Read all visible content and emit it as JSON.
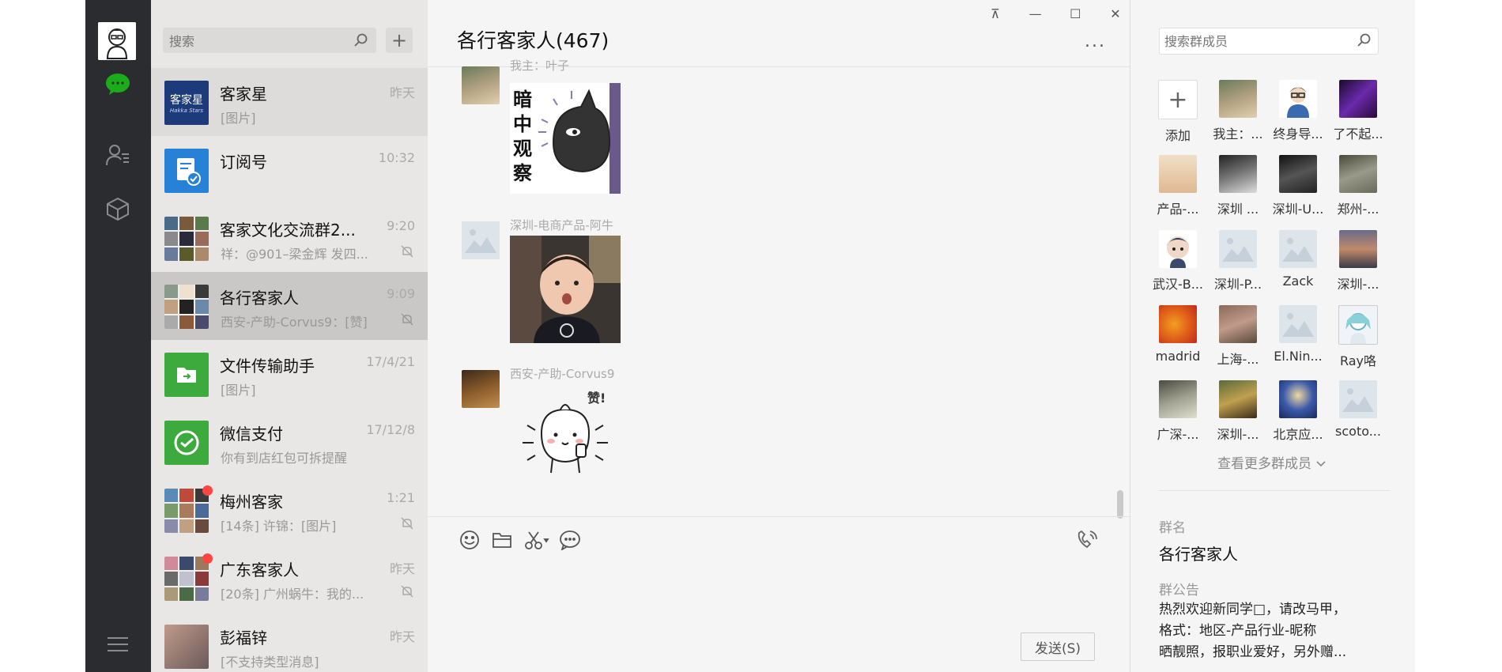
{
  "chat_list": {
    "search_placeholder": "搜索",
    "add_symbol": "+",
    "items": [
      {
        "name": "客家星",
        "time": "昨天",
        "preview": "[图片]",
        "logo_text": "客家星",
        "logo_sub": "Hakka Stars"
      },
      {
        "name": "订阅号",
        "time": "10:32",
        "preview": ""
      },
      {
        "name": "客家文化交流群2...",
        "time": "9:20",
        "preview": "祥：@901–梁金辉 发四..."
      },
      {
        "name": "各行客家人",
        "time": "9:09",
        "preview": "西安-产助-Corvus9：[赞]"
      },
      {
        "name": "文件传输助手",
        "time": "17/4/21",
        "preview": "[图片]"
      },
      {
        "name": "微信支付",
        "time": "17/12/8",
        "preview": "你有到店红包可拆提醒"
      },
      {
        "name": "梅州客家",
        "time": "1:21",
        "preview": "[14条] 许锦：[图片]"
      },
      {
        "name": "广东客家人",
        "time": "昨天",
        "preview": "[20条] 广州蜗牛：我的..."
      },
      {
        "name": "彭福锌",
        "time": "昨天",
        "preview": "[不支持类型消息]"
      }
    ]
  },
  "chat": {
    "title": "各行客家人(467)",
    "more": "...",
    "window_buttons": [
      "⊼",
      "—",
      "☐",
      "✕"
    ],
    "messages": [
      {
        "sender": "我主：叶子",
        "sticker_text": [
          "暗",
          "中",
          "观",
          "察"
        ]
      },
      {
        "sender": "深圳-电商产品-阿牛"
      },
      {
        "sender": "西安-产助-Corvus9",
        "sticker_text": "赞!"
      }
    ],
    "send_label": "发送(S)"
  },
  "panel": {
    "search_placeholder": "搜索群成员",
    "add_label": "添加",
    "add_symbol": "+",
    "members": [
      "我主：...",
      "终身导...",
      "了不起...",
      "产品-...",
      "深圳 ...",
      "深圳-U...",
      "郑州-...",
      "武汉-B...",
      "深圳-P...",
      "Zack",
      "深圳-...",
      "madrid",
      "上海-...",
      "El.Nin...",
      "Ray咯",
      "广深-...",
      "深圳-...",
      "北京应...",
      "scoto..."
    ],
    "see_more": "查看更多群成员",
    "group_name_label": "群名",
    "group_name": "各行客家人",
    "notice_label": "群公告",
    "notice_lines": [
      "热烈欢迎新同学□，请改马甲，",
      "格式：地区-产品行业-昵称",
      "晒靓照，报职业爱好，另外赠..."
    ]
  },
  "colors": {
    "nav_bg": "#2b2c2f",
    "list_bg": "#e8e7e6",
    "active_bg": "#cac8c6",
    "accent_green": "#1aad19",
    "badge_red": "#f44444"
  }
}
